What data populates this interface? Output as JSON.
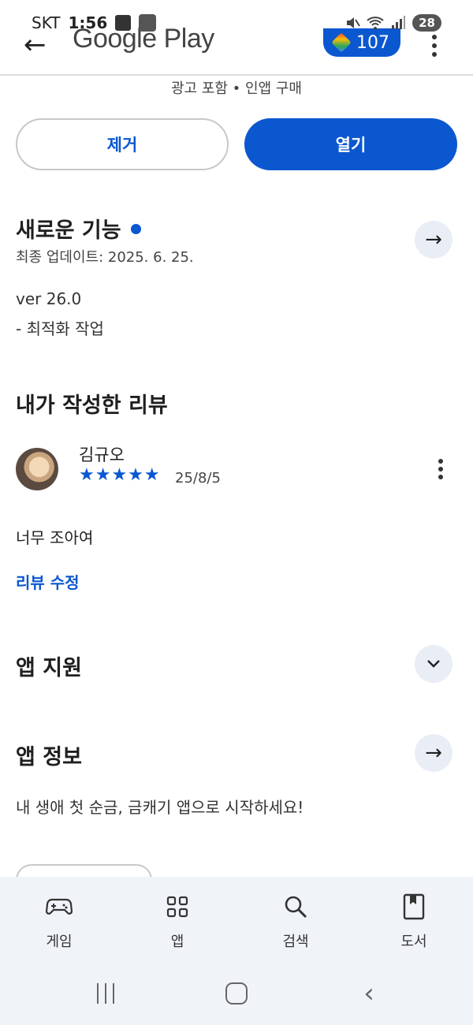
{
  "status_bar": {
    "carrier": "SKT",
    "time": "1:56",
    "battery": "28"
  },
  "app_bar": {
    "logo_text": "Google Play",
    "points": "107"
  },
  "app": {
    "ads_info": "광고 포함 • 인앱 구매",
    "remove_label": "제거",
    "open_label": "열기"
  },
  "whats_new": {
    "title": "새로운 기능",
    "updated": "최종 업데이트: 2025. 6. 25.",
    "version": "ver 26.0",
    "notes": "- 최적화 작업"
  },
  "my_review": {
    "title": "내가 작성한 리뷰",
    "reviewer": "김규오",
    "rating": 5,
    "stars": "★★★★★",
    "date": "25/8/5",
    "text": "너무 조아여",
    "edit_label": "리뷰 수정"
  },
  "app_support": {
    "title": "앱 지원"
  },
  "app_info": {
    "title": "앱 정보",
    "description": "내 생애 첫 순금, 금캐기 앱으로 시작하세요!"
  },
  "bottom_nav": [
    {
      "label": "게임",
      "icon": "gamepad-icon"
    },
    {
      "label": "앱",
      "icon": "apps-grid-icon"
    },
    {
      "label": "검색",
      "icon": "search-icon"
    },
    {
      "label": "도서",
      "icon": "book-icon"
    }
  ],
  "colors": {
    "accent": "#0b57d0",
    "nav_background": "#f0f4f9",
    "round_button": "#e9eef6"
  }
}
